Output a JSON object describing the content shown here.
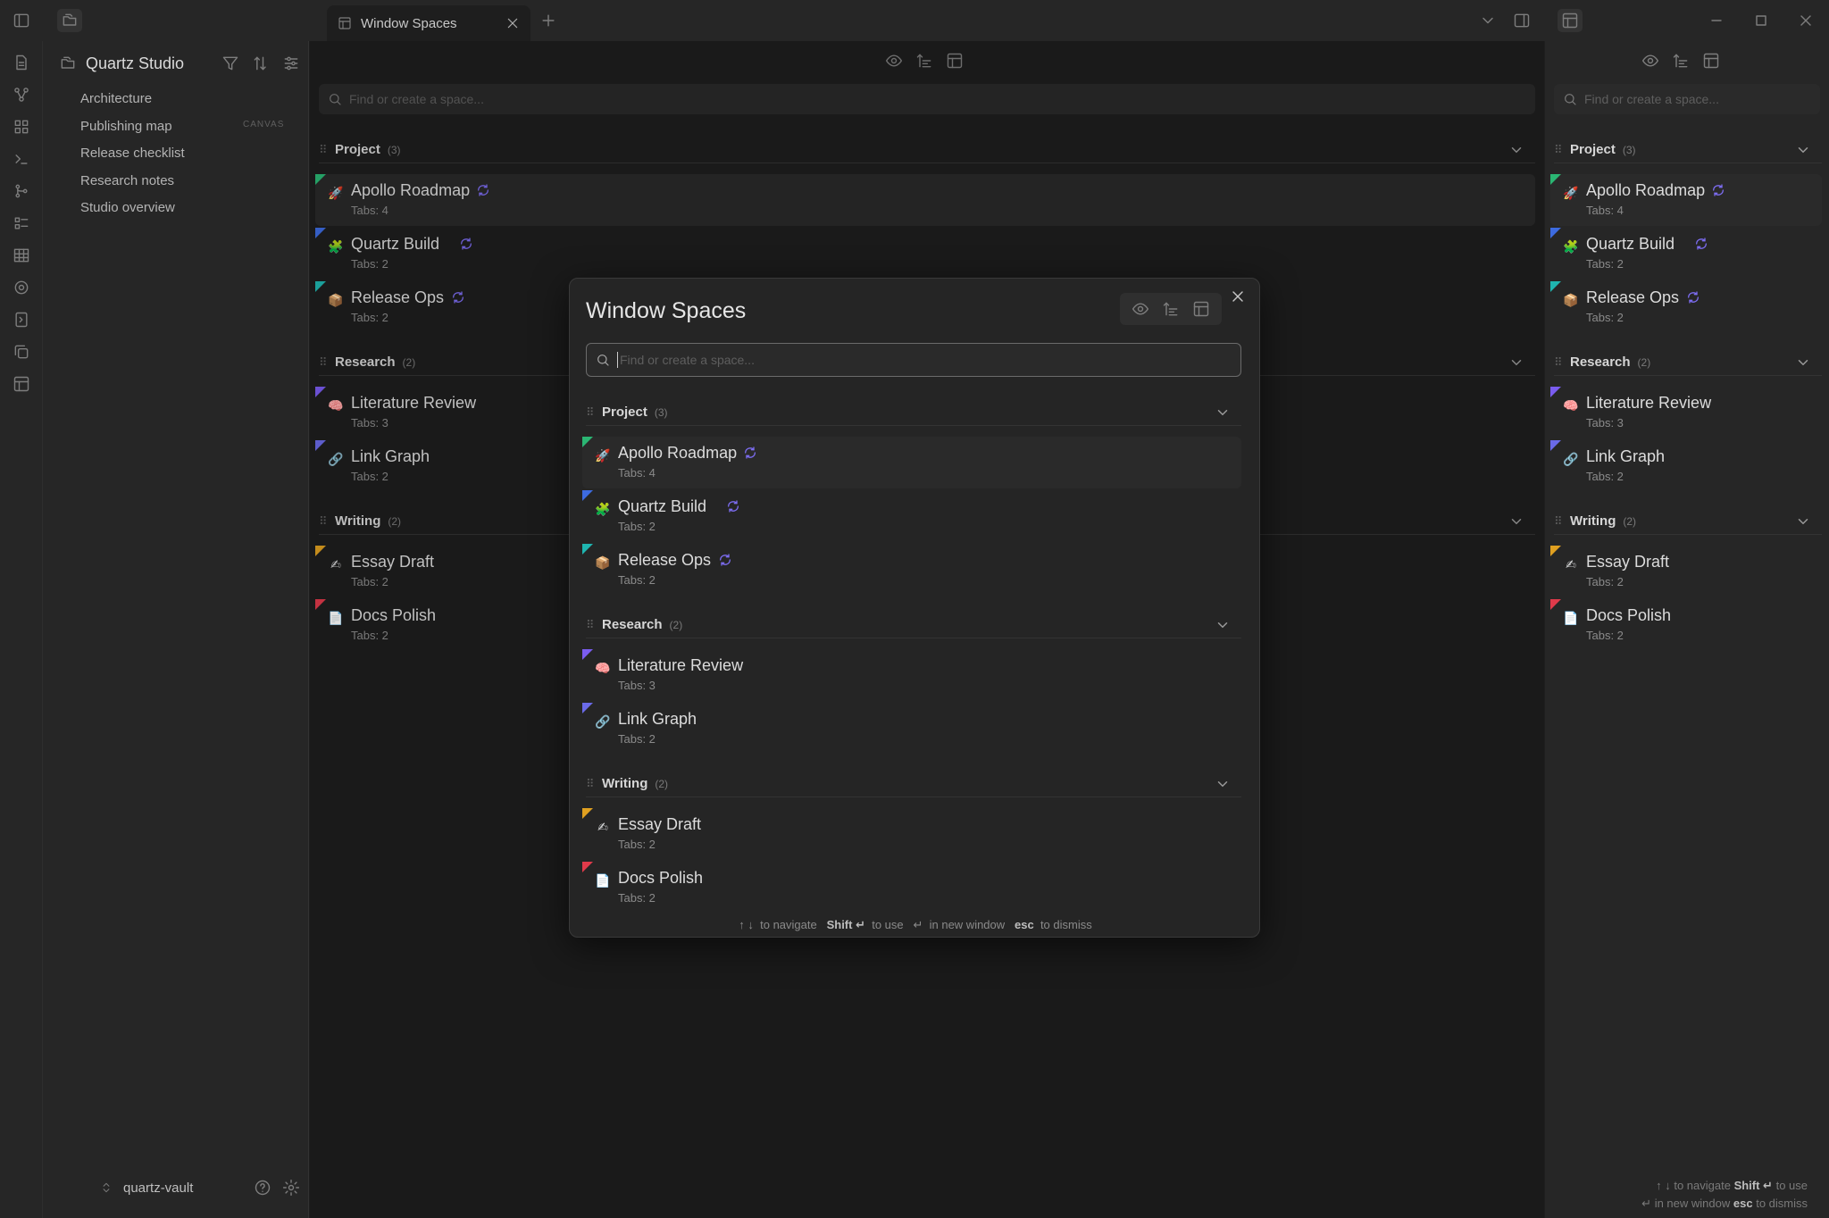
{
  "window": {
    "tab_title": "Window Spaces",
    "controls": [
      "minimize-icon",
      "maximize-icon",
      "close-icon"
    ]
  },
  "ribbon": {
    "icons": [
      "file-icon",
      "graph-icon",
      "grid-icon",
      "terminal-icon",
      "git-icon",
      "list-icon",
      "table-icon",
      "target-icon",
      "export-icon",
      "copy-icon",
      "layout-icon"
    ]
  },
  "sidebar": {
    "vault_title": "Quartz Studio",
    "items": [
      {
        "label": "Architecture"
      },
      {
        "label": "Publishing map",
        "badge": "CANVAS"
      },
      {
        "label": "Release checklist"
      },
      {
        "label": "Research notes"
      },
      {
        "label": "Studio overview"
      }
    ],
    "vault_name": "quartz-vault"
  },
  "search": {
    "placeholder": "Find or create a space..."
  },
  "groups": [
    {
      "name": "Project",
      "count": "(3)",
      "spaces": [
        {
          "name": "Apollo Roadmap",
          "tabs": "Tabs: 4",
          "emoji": "🚀",
          "color": "#2bb673",
          "sync": true,
          "selected": true
        },
        {
          "name": "Quartz Build",
          "tabs": "Tabs: 2",
          "emoji": "🧩",
          "color": "#3d6be0",
          "sync": true
        },
        {
          "name": "Release Ops",
          "tabs": "Tabs: 2",
          "emoji": "📦",
          "color": "#1fb5b0",
          "sync": true
        }
      ]
    },
    {
      "name": "Research",
      "count": "(2)",
      "spaces": [
        {
          "name": "Literature Review",
          "tabs": "Tabs: 3",
          "emoji": "🧠",
          "color": "#7a5cf0"
        },
        {
          "name": "Link Graph",
          "tabs": "Tabs: 2",
          "emoji": "🔗",
          "color": "#6a6ae8"
        }
      ]
    },
    {
      "name": "Writing",
      "count": "(2)",
      "spaces": [
        {
          "name": "Essay Draft",
          "tabs": "Tabs: 2",
          "emoji": "✍",
          "color": "#e0a020"
        },
        {
          "name": "Docs Polish",
          "tabs": "Tabs: 2",
          "emoji": "📄",
          "color": "#e03a4a"
        }
      ]
    }
  ],
  "modal": {
    "title": "Window Spaces",
    "hint": {
      "nav_keys": "↑ ↓",
      "nav_text": "to navigate",
      "use_keys": "Shift ↵",
      "use_text": "to use",
      "new_keys": "↵",
      "new_text": "in new window",
      "esc_keys": "esc",
      "esc_text": "to dismiss"
    }
  },
  "colors": {
    "accent_sync": "#7c6cf0",
    "background": "#1e1e1e",
    "panel": "#262626"
  }
}
